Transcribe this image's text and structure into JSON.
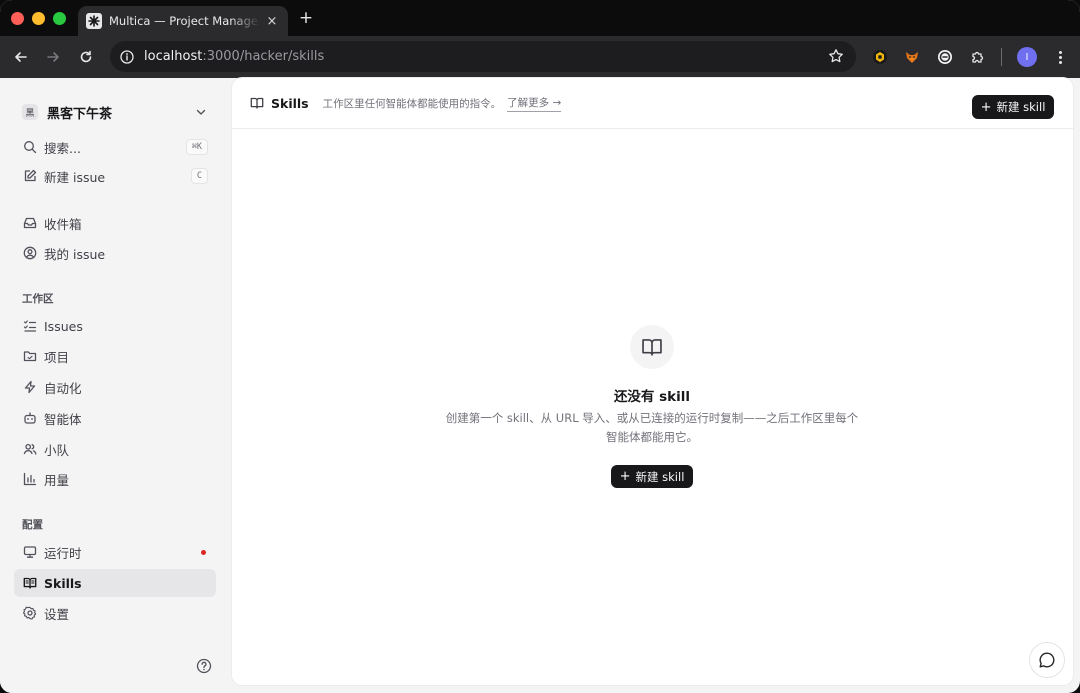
{
  "browser": {
    "tab_title": "Multica — Project Management",
    "tab_close": "×",
    "new_tab": "+",
    "url_host": "localhost",
    "url_rest": ":3000/hacker/skills",
    "profile_initial": "I"
  },
  "sidebar": {
    "workspace_initial": "黑",
    "workspace_name": "黑客下午茶",
    "search_label": "搜索...",
    "search_shortcut": "⌘K",
    "new_issue_label": "新建 issue",
    "new_issue_shortcut": "C",
    "inbox_label": "收件箱",
    "my_issues_label": "我的 issue",
    "workspace_section": "工作区",
    "issues_label": "Issues",
    "projects_label": "项目",
    "automation_label": "自动化",
    "agents_label": "智能体",
    "squads_label": "小队",
    "usage_label": "用量",
    "config_section": "配置",
    "runtime_label": "运行时",
    "skills_label": "Skills",
    "settings_label": "设置"
  },
  "header": {
    "title": "Skills",
    "description": "工作区里任何智能体都能使用的指令。",
    "learn_more": "了解更多 →",
    "new_button": "新建 skill"
  },
  "empty_state": {
    "title": "还没有 skill",
    "description": "创建第一个 skill、从 URL 导入、或从已连接的运行时复制——之后工作区里每个智能体都能用它。",
    "button": "新建 skill"
  },
  "colors": {
    "accent_dark": "#18181b",
    "runtime_dot": "#dc2626",
    "profile": "#6f6ff0"
  }
}
